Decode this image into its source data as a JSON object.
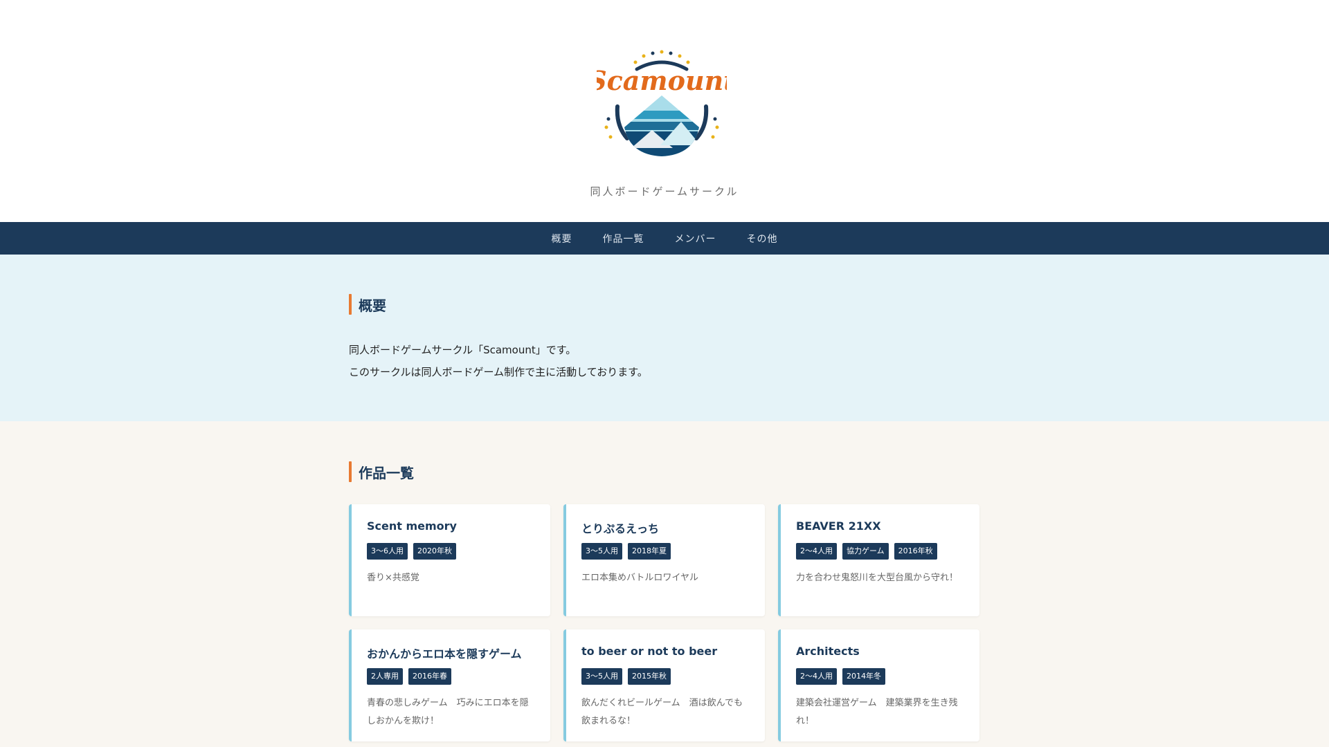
{
  "header": {
    "logo_text": "Scamount",
    "tagline": "同人ボードゲームサークル"
  },
  "nav": {
    "items": [
      "概要",
      "作品一覧",
      "メンバー",
      "その他"
    ]
  },
  "about": {
    "heading": "概要",
    "lines": [
      "同人ボードゲームサークル「Scamount」です。",
      "このサークルは同人ボードゲーム制作で主に活動しております。"
    ]
  },
  "works": {
    "heading": "作品一覧",
    "cards": [
      {
        "title": "Scent memory",
        "tags": [
          "3〜6人用",
          "2020年秋"
        ],
        "desc": "香り×共感覚"
      },
      {
        "title": "とりぷるえっち",
        "tags": [
          "3〜5人用",
          "2018年夏"
        ],
        "desc": "エロ本集めバトルロワイヤル"
      },
      {
        "title": "BEAVER 21XX",
        "tags": [
          "2〜4人用",
          "協力ゲーム",
          "2016年秋"
        ],
        "desc": "力を合わせ鬼怒川を大型台風から守れ！"
      },
      {
        "title": "おかんからエロ本を隠すゲーム",
        "tags": [
          "2人専用",
          "2016年春"
        ],
        "desc": "青春の悲しみゲーム　巧みにエロ本を隠しおかんを欺け！"
      },
      {
        "title": "to beer or not to beer",
        "tags": [
          "3〜5人用",
          "2015年秋"
        ],
        "desc": "飲んだくれビールゲーム　酒は飲んでも飲まれるな！"
      },
      {
        "title": "Architects",
        "tags": [
          "2〜4人用",
          "2014年冬"
        ],
        "desc": "建築会社運営ゲーム　建築業界を生き残れ！"
      }
    ]
  },
  "colors": {
    "navy": "#1c3a5a",
    "accent_orange": "#e87a32",
    "card_border": "#85cbe0",
    "about_bg": "#e5f3f8",
    "works_bg": "#f9f6f1"
  }
}
